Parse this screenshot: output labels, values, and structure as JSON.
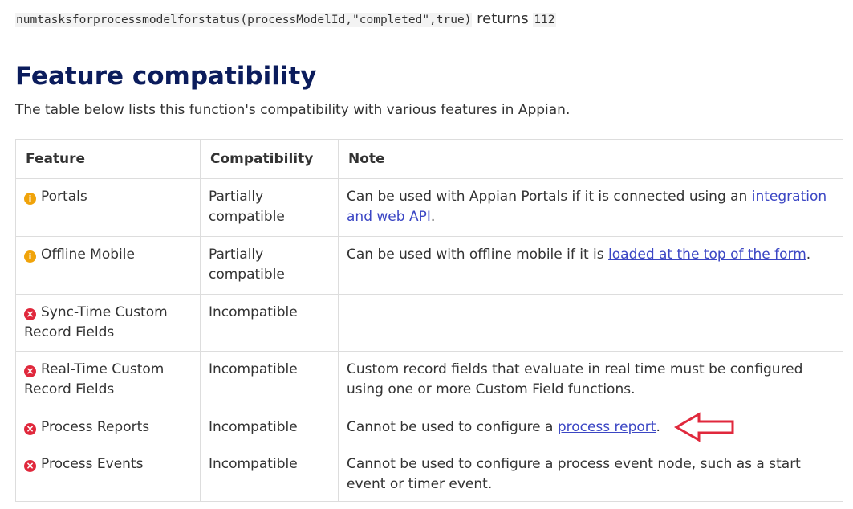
{
  "example": {
    "code": "numtasksforprocessmodelforstatus(processModelId,\"completed\",true)",
    "returns_text": "returns",
    "result": "112"
  },
  "section": {
    "title": "Feature compatibility",
    "intro": "The table below lists this function's compatibility with various features in Appian."
  },
  "table": {
    "headers": {
      "feature": "Feature",
      "compatibility": "Compatibility",
      "note": "Note"
    },
    "rows": [
      {
        "icon": "info-icon",
        "feature": "Portals",
        "compatibility": "Partially compatible",
        "note_before": "Can be used with Appian Portals if it is connected using an ",
        "note_link": "integration and web API",
        "note_after": "."
      },
      {
        "icon": "info-icon",
        "feature": "Offline Mobile",
        "compatibility": "Partially compatible",
        "note_before": "Can be used with offline mobile if it is ",
        "note_link": "loaded at the top of the form",
        "note_after": "."
      },
      {
        "icon": "error-icon",
        "feature": "Sync-Time Custom Record Fields",
        "compatibility": "Incompatible",
        "note_before": "",
        "note_link": "",
        "note_after": ""
      },
      {
        "icon": "error-icon",
        "feature": "Real-Time Custom Record Fields",
        "compatibility": "Incompatible",
        "note_before": "Custom record fields that evaluate in real time must be configured using one or more Custom Field functions.",
        "note_link": "",
        "note_after": ""
      },
      {
        "icon": "error-icon",
        "feature": "Process Reports",
        "compatibility": "Incompatible",
        "note_before": "Cannot be used to configure a ",
        "note_link": "process report",
        "note_after": "."
      },
      {
        "icon": "error-icon",
        "feature": "Process Events",
        "compatibility": "Incompatible",
        "note_before": "Cannot be used to configure a process event node, such as a start event or timer event.",
        "note_link": "",
        "note_after": ""
      }
    ]
  },
  "annotation": {
    "arrow_color": "#e0283c",
    "arrow_icon": "left-arrow-icon"
  },
  "colors": {
    "heading": "#0b1c5c",
    "link": "#3b46c4",
    "info": "#f0a30a",
    "error": "#e0283c"
  }
}
